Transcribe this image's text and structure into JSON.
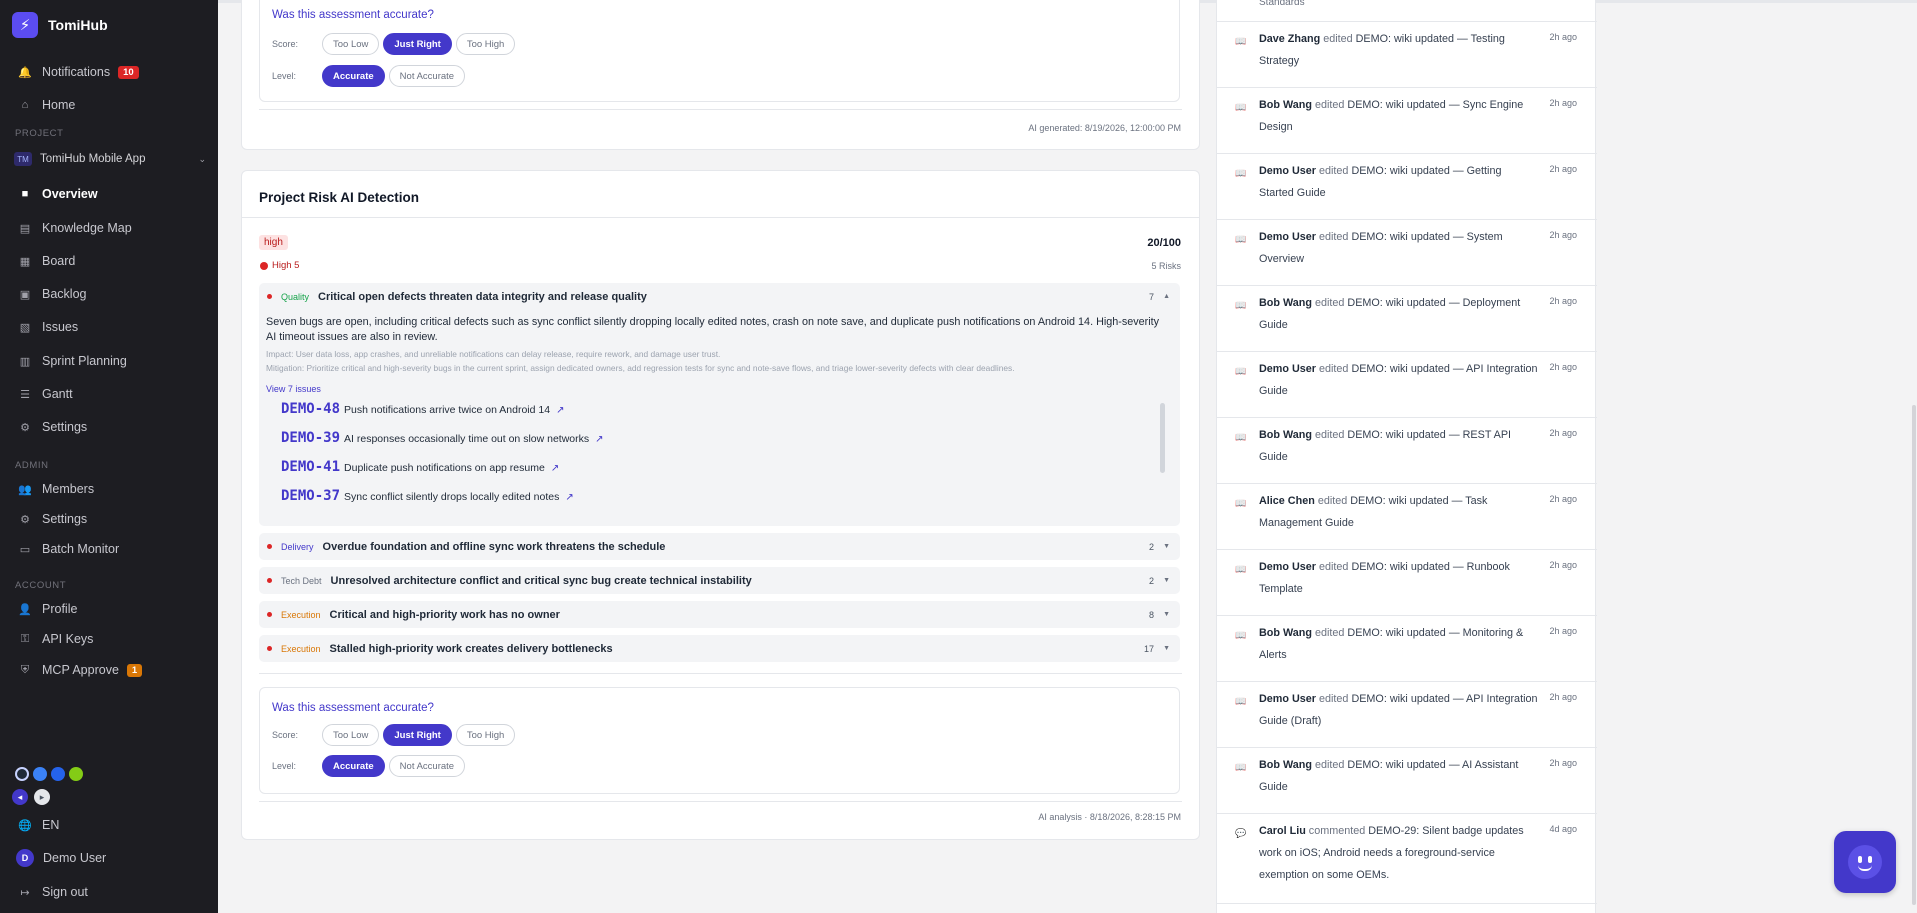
{
  "sidebar": {
    "brand": "TomiHub",
    "notifications_label": "Notifications",
    "notifications_count": "10",
    "home": "Home",
    "project_section": "PROJECT",
    "project_name": "TomiHub Mobile App",
    "project_initials": "TM",
    "nav": [
      "Overview",
      "Knowledge Map",
      "Board",
      "Backlog",
      "Issues",
      "Sprint Planning",
      "Gantt",
      "Settings"
    ],
    "admin_section": "ADMIN",
    "admin": [
      "Members",
      "Settings",
      "Batch Monitor"
    ],
    "account_section": "ACCOUNT",
    "account": [
      "Profile",
      "API Keys",
      "MCP Approve"
    ],
    "mcp_count": "1",
    "language": "EN",
    "user_initial": "D",
    "user_name": "Demo User",
    "sign_out": "Sign out",
    "swatch_colors": [
      "#1f2937",
      "#3b82f6",
      "#2563eb",
      "#84cc16"
    ]
  },
  "feedback_top": {
    "question": "Was this assessment accurate?",
    "score_label": "Score:",
    "score_options": [
      "Too Low",
      "Just Right",
      "Too High"
    ],
    "level_label": "Level:",
    "level_options": [
      "Accurate",
      "Not Accurate"
    ],
    "generated": "AI generated: 8/19/2026, 12:00:00 PM"
  },
  "risk_card": {
    "title": "Project Risk AI Detection",
    "level_tag": "high",
    "score": "20/100",
    "high_count": "High 5",
    "risks_count": "5 Risks",
    "expanded": {
      "category": "Quality",
      "title": "Critical open defects threaten data integrity and release quality",
      "count": "7",
      "description": "Seven bugs are open, including critical defects such as sync conflict silently dropping locally edited notes, crash on note save, and duplicate push notifications on Android 14. High-severity AI timeout issues are also in review.",
      "impact": "Impact: User data loss, app crashes, and unreliable notifications can delay release, require rework, and damage user trust.",
      "mitigation": "Mitigation: Prioritize critical and high-severity bugs in the current sprint, assign dedicated owners, add regression tests for sync and note-save flows, and triage lower-severity defects with clear deadlines.",
      "view_link": "View 7 issues",
      "issues": [
        {
          "key": "DEMO-48",
          "title": "Push notifications arrive twice on Android 14"
        },
        {
          "key": "DEMO-39",
          "title": "AI responses occasionally time out on slow networks"
        },
        {
          "key": "DEMO-41",
          "title": "Duplicate push notifications on app resume"
        },
        {
          "key": "DEMO-37",
          "title": "Sync conflict silently drops locally edited notes"
        }
      ]
    },
    "collapsed": [
      {
        "category": "Delivery",
        "title": "Overdue foundation and offline sync work threatens the schedule",
        "count": "2",
        "color": "#4338ca"
      },
      {
        "category": "Tech Debt",
        "title": "Unresolved architecture conflict and critical sync bug create technical instability",
        "count": "2",
        "color": "#6b7280"
      },
      {
        "category": "Execution",
        "title": "Critical and high-priority work has no owner",
        "count": "8",
        "color": "#d97706"
      },
      {
        "category": "Execution",
        "title": "Stalled high-priority work creates delivery bottlenecks",
        "count": "17",
        "color": "#d97706"
      }
    ],
    "feedback": {
      "question": "Was this assessment accurate?",
      "score_label": "Score:",
      "score_options": [
        "Too Low",
        "Just Right",
        "Too High"
      ],
      "level_label": "Level:",
      "level_options": [
        "Accurate",
        "Not Accurate"
      ]
    },
    "analysis": "AI analysis · 8/18/2026, 8:28:15 PM"
  },
  "activity": {
    "top_partial": "Standards",
    "items": [
      {
        "who": "Dave Zhang",
        "verb": "edited",
        "text": "DEMO: wiki updated — Testing Strategy",
        "time": "2h ago"
      },
      {
        "who": "Bob Wang",
        "verb": "edited",
        "text": "DEMO: wiki updated — Sync Engine Design",
        "time": "2h ago"
      },
      {
        "who": "Demo User",
        "verb": "edited",
        "text": "DEMO: wiki updated — Getting Started Guide",
        "time": "2h ago"
      },
      {
        "who": "Demo User",
        "verb": "edited",
        "text": "DEMO: wiki updated — System Overview",
        "time": "2h ago"
      },
      {
        "who": "Bob Wang",
        "verb": "edited",
        "text": "DEMO: wiki updated — Deployment Guide",
        "time": "2h ago"
      },
      {
        "who": "Demo User",
        "verb": "edited",
        "text": "DEMO: wiki updated — API Integration Guide",
        "time": "2h ago"
      },
      {
        "who": "Bob Wang",
        "verb": "edited",
        "text": "DEMO: wiki updated — REST API Guide",
        "time": "2h ago"
      },
      {
        "who": "Alice Chen",
        "verb": "edited",
        "text": "DEMO: wiki updated — Task Management Guide",
        "time": "2h ago"
      },
      {
        "who": "Demo User",
        "verb": "edited",
        "text": "DEMO: wiki updated — Runbook Template",
        "time": "2h ago"
      },
      {
        "who": "Bob Wang",
        "verb": "edited",
        "text": "DEMO: wiki updated — Monitoring & Alerts",
        "time": "2h ago"
      },
      {
        "who": "Demo User",
        "verb": "edited",
        "text": "DEMO: wiki updated — API Integration Guide (Draft)",
        "time": "2h ago"
      },
      {
        "who": "Bob Wang",
        "verb": "edited",
        "text": "DEMO: wiki updated — AI Assistant Guide",
        "time": "2h ago"
      },
      {
        "who": "Carol Liu",
        "verb": "commented",
        "text": "DEMO-29: Silent badge updates work on iOS; Android needs a foreground-service exemption on some OEMs.",
        "time": "4d ago"
      }
    ]
  }
}
